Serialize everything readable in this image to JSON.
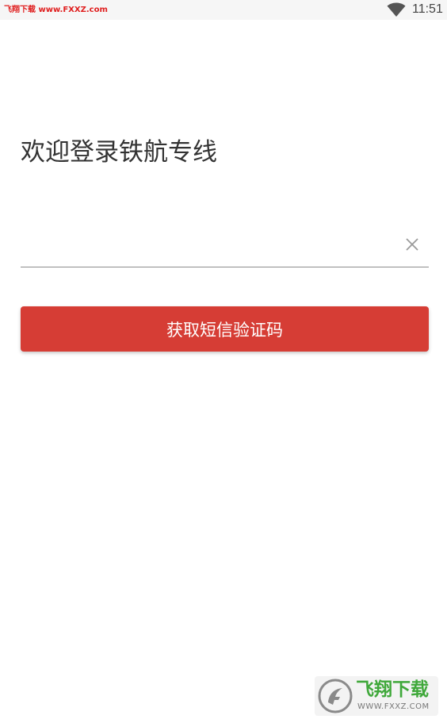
{
  "status_bar": {
    "watermark": "飞翔下载 www.FXXZ.com",
    "time": "11:51",
    "wifi_icon": "wifi-icon"
  },
  "login": {
    "title": "欢迎登录铁航专线",
    "phone_input": {
      "value": "",
      "placeholder": ""
    },
    "clear_icon": "close-icon",
    "button_label": "获取短信验证码"
  },
  "watermark_logo": {
    "brand": "飞翔下载",
    "url": "WWW.FXXZ.COM"
  },
  "colors": {
    "button": "#d63d35",
    "watermark_red": "#e02020",
    "logo_green": "#3fa83a"
  }
}
